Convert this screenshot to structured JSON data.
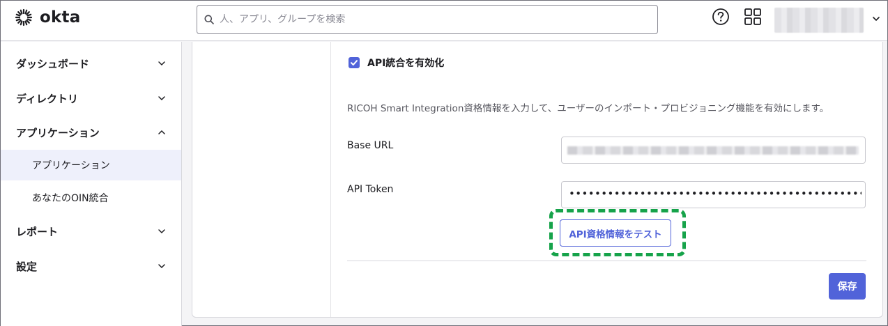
{
  "header": {
    "logo_text": "okta",
    "search_placeholder": "人、アプリ、グループを検索"
  },
  "sidebar": {
    "items": [
      {
        "label": "ダッシュボード",
        "chevron": "chevron-down"
      },
      {
        "label": "ディレクトリ",
        "chevron": "chevron-down"
      },
      {
        "label": "アプリケーション",
        "chevron": "chevron-up"
      },
      {
        "label": "レポート",
        "chevron": "chevron-down"
      },
      {
        "label": "設定",
        "chevron": "chevron-down"
      }
    ],
    "subitems": [
      {
        "label": "アプリケーション",
        "active": true
      },
      {
        "label": "あなたのOIN統合",
        "active": false
      }
    ]
  },
  "form": {
    "enable_api_label": "API統合を有効化",
    "enable_api_checked": true,
    "description": "RICOH Smart Integration資格情報を入力して、ユーザーのインポート・プロビジョニング機能を有効にします。",
    "base_url_label": "Base URL",
    "api_token_label": "API Token",
    "api_token_value": "•••••••••••••••••••••••••••••••••••••••••••••••••••••••",
    "test_button_label": "API資格情報をテスト",
    "save_button_label": "保存"
  },
  "colors": {
    "accent": "#5163d9",
    "highlight": "#16a34a",
    "active_nav_bg": "#eef0fb"
  }
}
